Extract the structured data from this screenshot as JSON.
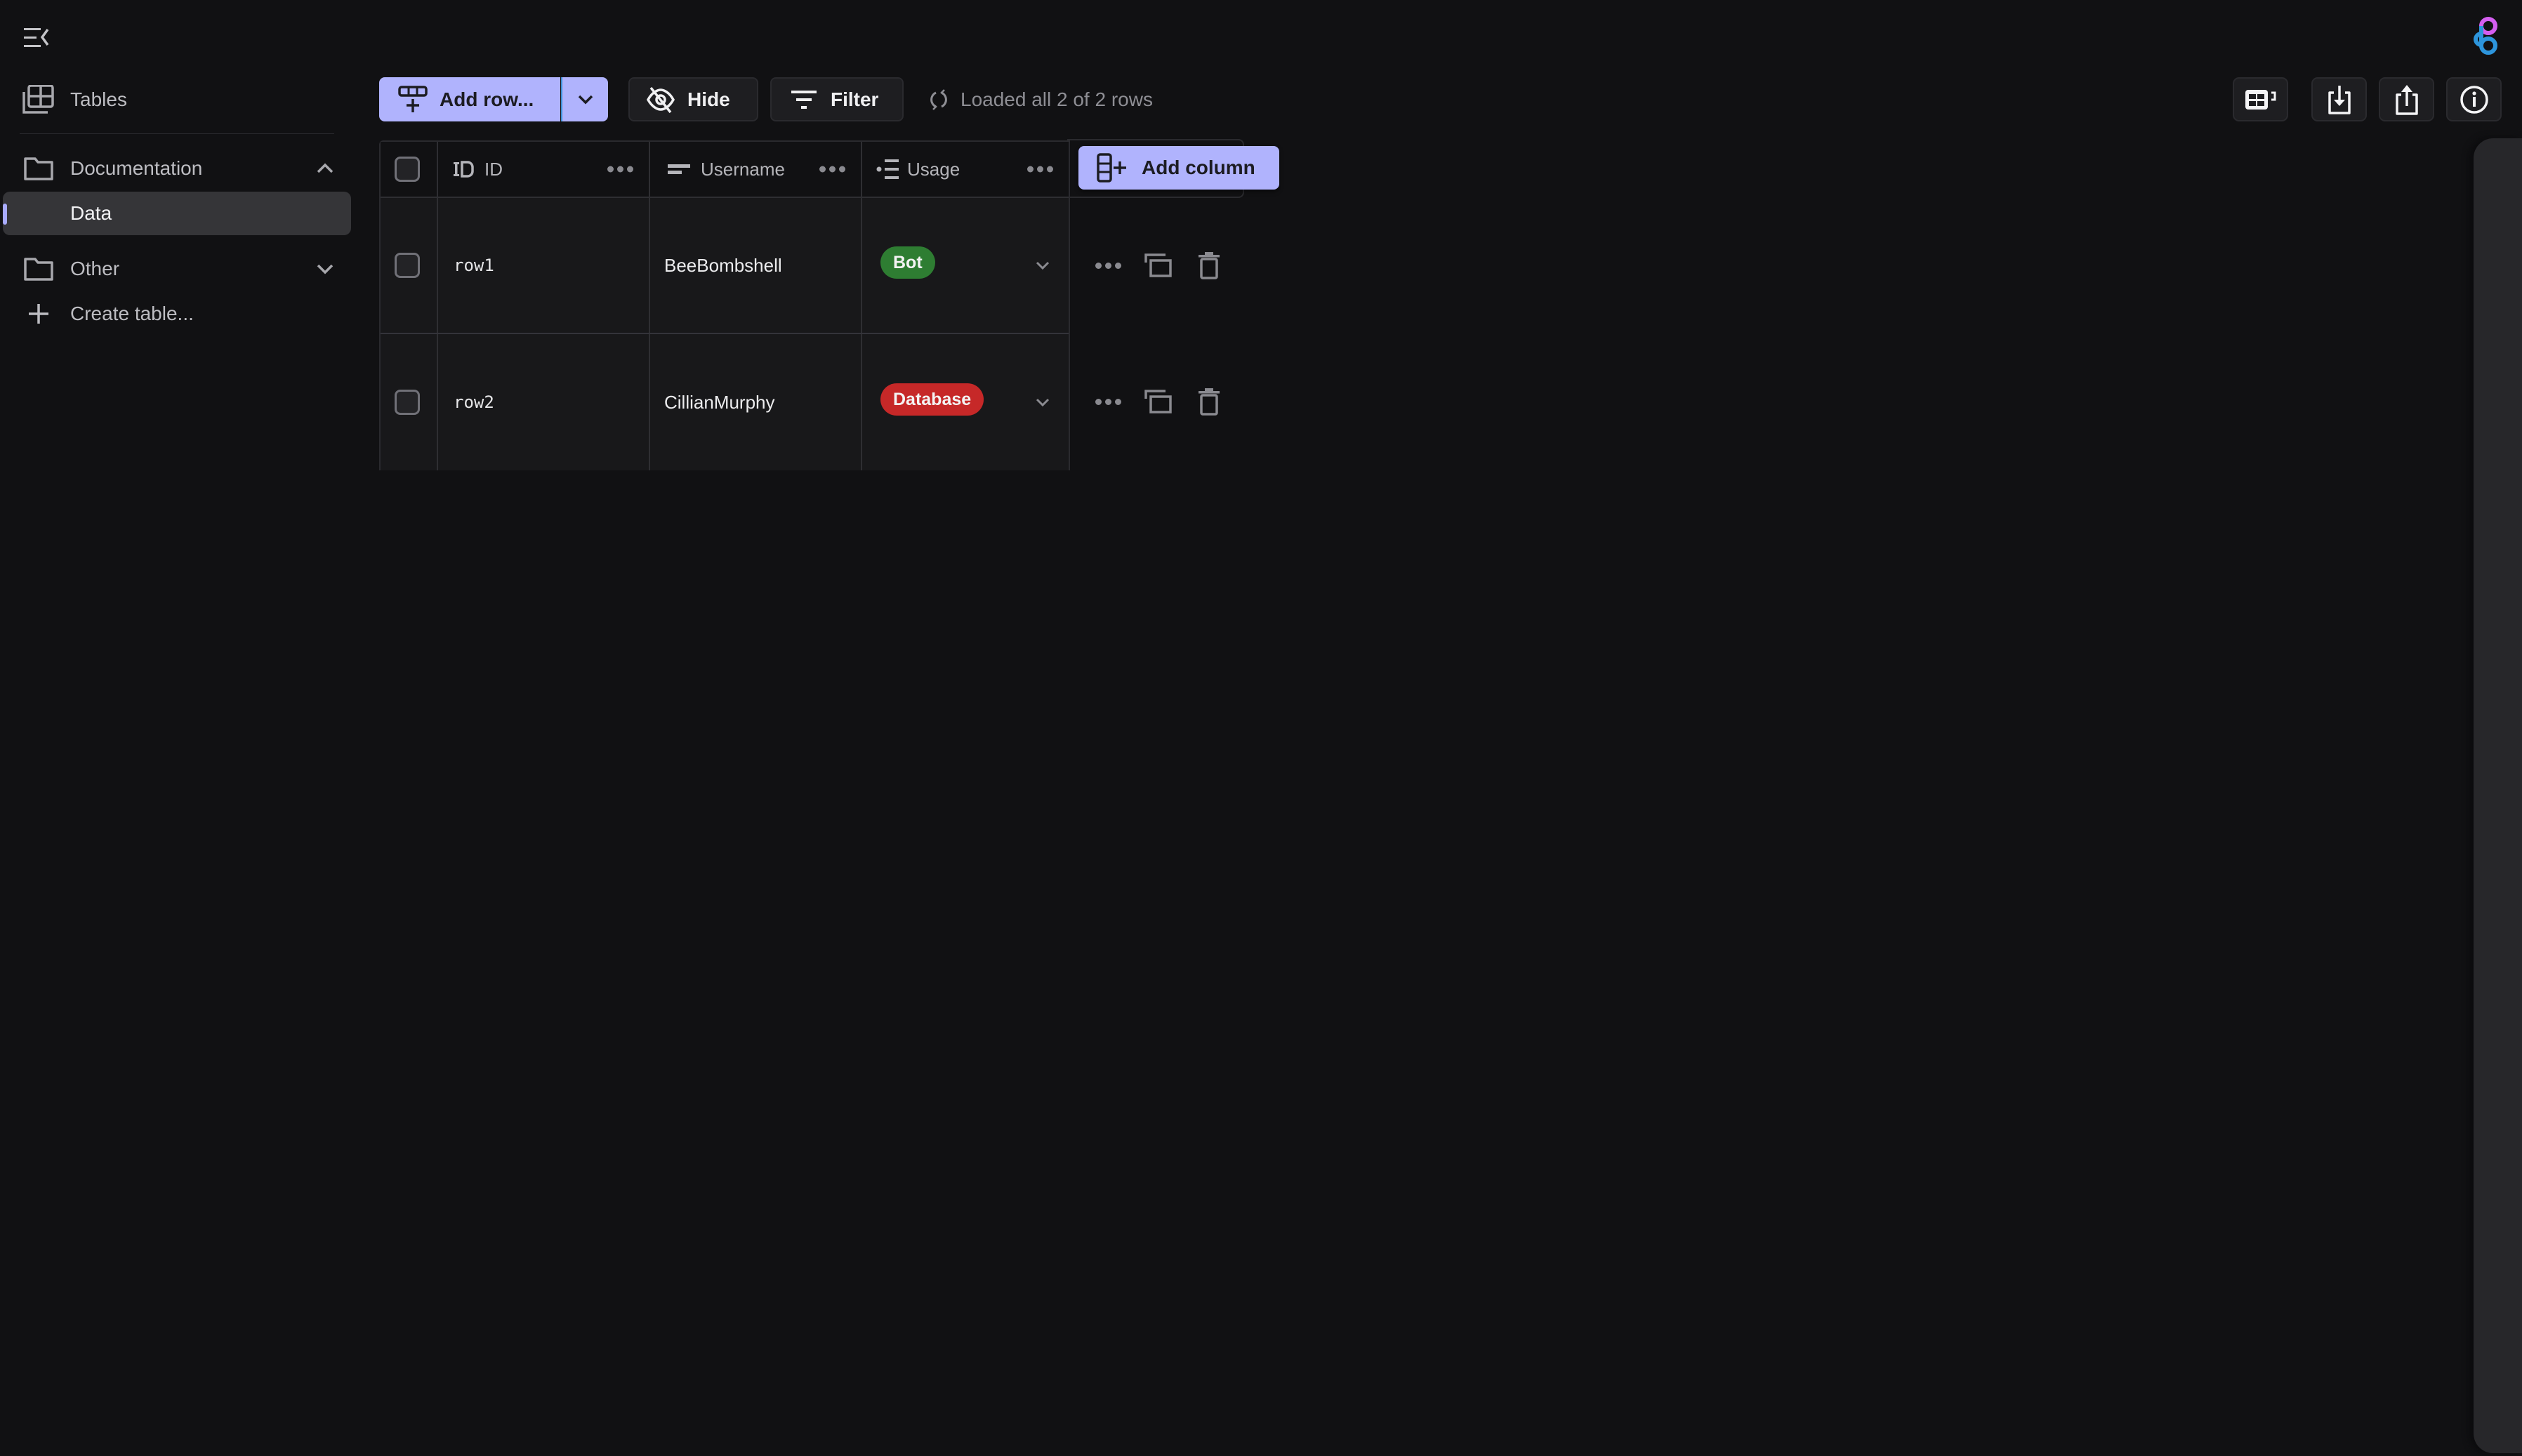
{
  "sidebar": {
    "toggle_icon": "menu-collapse-icon",
    "tables_label": "Tables",
    "folders": [
      {
        "label": "Documentation",
        "expanded": true,
        "items": [
          {
            "label": "Data",
            "active": true
          }
        ]
      },
      {
        "label": "Other",
        "expanded": false,
        "items": []
      }
    ],
    "create_table_label": "Create table..."
  },
  "toolbar": {
    "add_row_label": "Add row...",
    "hide_label": "Hide",
    "filter_label": "Filter",
    "status_text": "Loaded all 2 of 2 rows"
  },
  "top_right": {
    "icons": [
      "table-view-icon",
      "import-icon",
      "export-icon",
      "info-icon"
    ]
  },
  "table": {
    "columns": [
      {
        "label": "ID",
        "type_icon": "id-icon"
      },
      {
        "label": "Username",
        "type_icon": "text-icon"
      },
      {
        "label": "Usage",
        "type_icon": "select-icon"
      }
    ],
    "add_column_label": "Add column",
    "rows": [
      {
        "id": "row1",
        "username": "BeeBombshell",
        "usage": {
          "label": "Bot",
          "color": "#2e7d32"
        }
      },
      {
        "id": "row2",
        "username": "CillianMurphy",
        "usage": {
          "label": "Database",
          "color": "#c62828"
        }
      }
    ]
  },
  "colors": {
    "accent": "#b0b3fd",
    "background": "#111113",
    "row_background": "#18181a"
  }
}
